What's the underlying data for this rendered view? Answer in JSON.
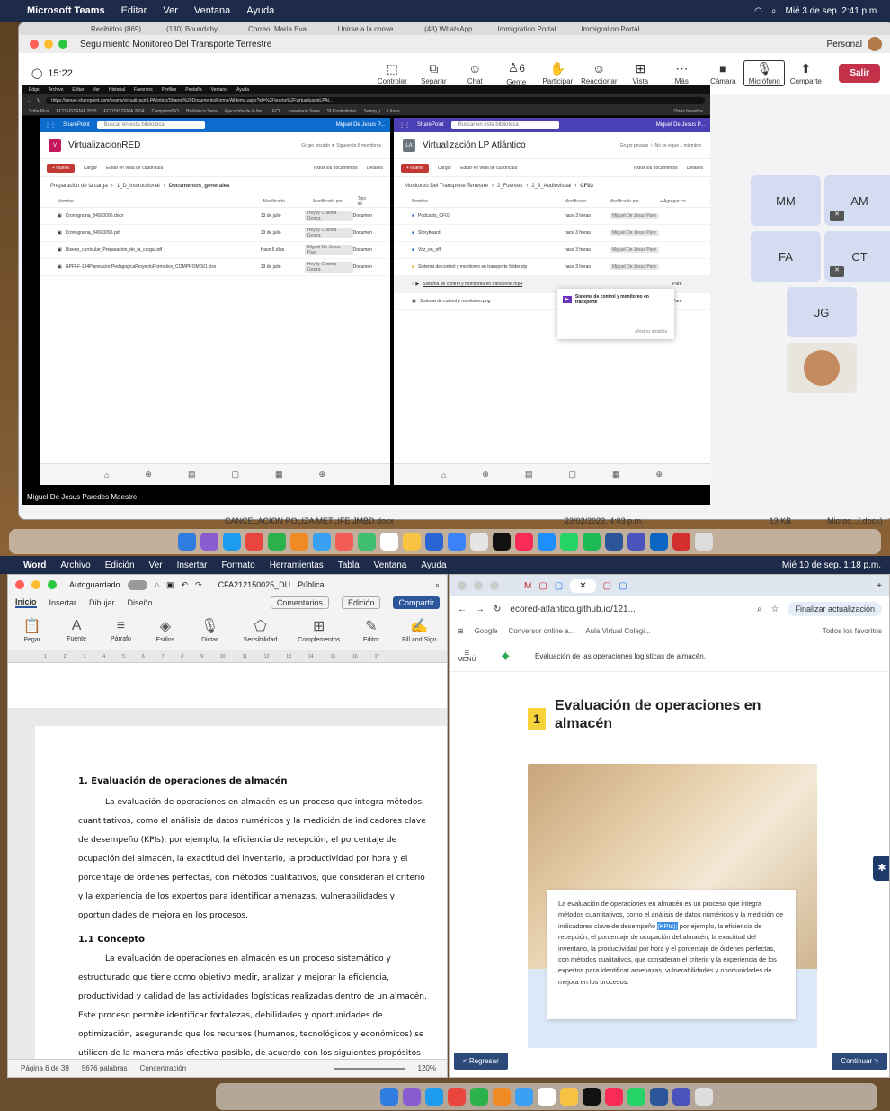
{
  "top_menubar": {
    "app": "Microsoft Teams",
    "items": [
      "Editar",
      "Ver",
      "Ventana",
      "Ayuda"
    ],
    "clock": "Mié 3 de sep. 2:41 p.m."
  },
  "teams": {
    "browser_tabs": [
      "Recibidos (869)",
      "(130) Boundaby...",
      "Correo: Maria Eva...",
      "Unirse a la conve...",
      "(48) WhatsApp",
      "Immigration Portal",
      "Immigration Portal"
    ],
    "window_title": "Seguimiento Monitoreo Del Transporte Terrestre",
    "profile": "Personal",
    "timer": "15:22",
    "toolbar": [
      {
        "label": "Controlar",
        "icon": "control-icon"
      },
      {
        "label": "Separar",
        "icon": "popout-icon"
      },
      {
        "label": "Chat",
        "icon": "chat-icon"
      },
      {
        "label": "Gente",
        "icon": "people-icon",
        "count": "6"
      },
      {
        "label": "Participar",
        "icon": "raise-hand-icon"
      },
      {
        "label": "Reaccionar",
        "icon": "react-icon"
      },
      {
        "label": "Vista",
        "icon": "view-icon"
      },
      {
        "label": "Más",
        "icon": "more-icon"
      },
      {
        "label": "Cámara",
        "icon": "camera-off-icon"
      },
      {
        "label": "Micrófono",
        "icon": "mic-icon"
      },
      {
        "label": "Comparte",
        "icon": "share-icon"
      }
    ],
    "leave_label": "Salir",
    "presenter": "Miguel De Jesus Paredes Maestre",
    "participants": [
      "MM",
      "AM",
      "FA",
      "CT",
      "JG"
    ]
  },
  "shared": {
    "menu": [
      "Edge",
      "Archivo",
      "Editar",
      "Ver",
      "Historial",
      "Favoritos",
      "Perfiles",
      "Pestaña",
      "Ventana",
      "Ayuda"
    ],
    "url": "https://sena4.sharepoint.com/teams/virtualizacinLPAtlntico/Shared%20Documents/Forms/AllItems.aspx?id=%2Fteams%2FvirtualizacinLPAt...",
    "favorites": [
      "Sofia Plus",
      "ECOSISTEMA 2025",
      "ECOSISTEMA 2024",
      "CompromISO",
      "Biblioteca Sena",
      "Ejecución de la for...",
      "ECL",
      "Inventario Sena",
      "Sf Contratistas",
      "Sennp_t",
      "Libres",
      "Otros favoritos"
    ],
    "left": {
      "app": "SharePoint",
      "search": "Buscar en esta biblioteca",
      "user": "Miguel De Jesus P...",
      "site": "VirtualizacionRED",
      "site_meta": "Grupo privado  ★ Siguiendo  8 miembros",
      "new": "+ Nueva",
      "upload": "Cargar",
      "grid": "Editar en vista de cuadrícula",
      "alldocs": "Todos los documentos",
      "details": "Detalles",
      "breadcrumb": [
        "Preparación de la carga",
        "1_D_Instruccional",
        "Documentos_generales"
      ],
      "columns": [
        "Nombre",
        "Modificado",
        "Modificado por",
        "Tipo de"
      ],
      "files": [
        {
          "name": "Cronograma_84920096.docx",
          "mod": "13 de julio",
          "by": "Heydy Cristina Gonza",
          "type": "Documen"
        },
        {
          "name": "Cronograma_84920096.pdf",
          "mod": "13 de julio",
          "by": "Heydy Cristina Gonza",
          "type": "Documen"
        },
        {
          "name": "Diseno_curricular_Preparacion_de_la_carga.pdf",
          "mod": "Hace 6 días",
          "by": "Miguel De Jesus Pare",
          "type": "Documen"
        },
        {
          "name": "GPFI-F-134PlaneacionPedagogicaProyectoFormativo_COMPROMISO.xlsx",
          "mod": "13 de julio",
          "by": "Heydy Cristina Gonza",
          "type": "Documen"
        }
      ]
    },
    "right": {
      "app": "SharePoint",
      "search": "Buscar en esta biblioteca",
      "user": "Miguel De Jesus P...",
      "site": "Virtualización LP Atlántico",
      "site_meta": "Grupo privado  ☆ No se sigue  1 miembro",
      "new": "+ Nueva",
      "upload": "Cargar",
      "grid": "Editar en vista de cuadrícula",
      "alldocs": "Todos los documentos",
      "details": "Detalles",
      "breadcrumb": [
        "Monitoreo Del Transporte Terrestre",
        "2_Fuentes",
        "2_3_Audiovisual",
        "CF03"
      ],
      "columns": [
        "Nombre",
        "Modificado",
        "Modificado por",
        "+ Agregar co..."
      ],
      "files": [
        {
          "name": "Podcasts_CF03",
          "mod": "hace 3 horas",
          "by": "Miguel De Jesus Pare"
        },
        {
          "name": "Storyboard",
          "mod": "hace 3 horas",
          "by": "Miguel De Jesus Pare"
        },
        {
          "name": "Voz_en_off",
          "mod": "hace 3 horas",
          "by": "Miguel De Jesus Pare"
        },
        {
          "name": "Sistema de control y monitoreo en transporte folder.zip",
          "mod": "hace 3 horas",
          "by": "Miguel De Jesus Pare"
        },
        {
          "name": "Sistema de control y monitoreo en transporte.mp4",
          "mod": "",
          "by": "Pare"
        },
        {
          "name": "Sistema de control y monitoreo.png",
          "mod": "",
          "by": "Pare"
        }
      ],
      "hover_card": "Sistema de control y monitoreo en transporte",
      "hover_more": "Mostrar detalles"
    }
  },
  "behind_window": {
    "file": "CANCELACION POLIZA METLIFE JMBD.docx",
    "date": "23/02/2023, 4:03 p.m.",
    "size": "13 KB",
    "kind": "Micros...(.docx)"
  },
  "bottom_menubar": {
    "app": "Word",
    "items": [
      "Archivo",
      "Edición",
      "Ver",
      "Insertar",
      "Formato",
      "Herramientas",
      "Tabla",
      "Ventana",
      "Ayuda"
    ],
    "clock": "Mié 10 de sep. 1:18 p.m."
  },
  "word": {
    "autosave": "Autoguardado",
    "filename": "CFA212150025_DU",
    "visibility": "Pública",
    "tabs": [
      "Inicio",
      "Insertar",
      "Dibujar",
      "Diseño"
    ],
    "comments": "Comentarios",
    "editing": "Edición",
    "share": "Compartir",
    "ribbon": [
      "Pegar",
      "Fuente",
      "Párrafo",
      "Estilos",
      "Dictar",
      "Sensibilidad",
      "Complementos",
      "Editor",
      "Fill and Sign"
    ],
    "ruler": [
      "1",
      "2",
      "3",
      "4",
      "5",
      "6",
      "7",
      "8",
      "9",
      "10",
      "11",
      "12",
      "13",
      "14",
      "15",
      "16",
      "17"
    ],
    "heading1": "1. Evaluación de operaciones de almacén",
    "para1": "La evaluación de operaciones en almacén es un proceso que integra métodos cuantitativos, como el análisis de datos numéricos y la medición de indicadores clave de desempeño (KPIs); por ejemplo, la eficiencia de recepción, el porcentaje de ocupación del almacén, la exactitud del inventario, la productividad por hora y el porcentaje de órdenes perfectas, con métodos cualitativos, que consideran el criterio y la experiencia de los expertos para identificar amenazas, vulnerabilidades y oportunidades de mejora en los procesos.",
    "heading2": "1.1   Concepto",
    "para2": "La evaluación de operaciones en almacén es un proceso sistemático y estructurado que tiene como objetivo medir, analizar y mejorar la eficiencia, productividad y calidad de las actividades logísticas realizadas dentro de un almacén. Este proceso permite identificar fortalezas, debilidades y oportunidades de optimización, asegurando que los recursos (humanos, tecnológicos y económicos) se utilicen de la manera más efectiva posible, de acuerdo con los siguientes propósitos clave:",
    "status": {
      "page": "Página 6 de 39",
      "words": "5676 palabras",
      "focus": "Concentración",
      "zoom": "120%"
    }
  },
  "browser": {
    "url": "ecored-atlantico.github.io/121...",
    "update": "Finalizar actualización",
    "favorites": [
      "Google",
      "Conversor online a...",
      "Aula Virtual Colegi...",
      "Todos los favoritos"
    ],
    "menu": "MENÚ",
    "lms_header": "Evaluación de las operaciones logísticas de almacén.",
    "number": "1",
    "title": "Evaluación de operaciones en almacén",
    "text_pre": "La evaluación de operaciones en almacén es un proceso que integra métodos cuantitativos, como el análisis de datos numéricos y la medición de indicadores clave de desempeño ",
    "text_hl": "(KPIs);",
    "text_post": " por ejemplo, la eficiencia de recepción, el porcentaje de ocupación del almacén, la exactitud del inventario, la productividad por hora y el porcentaje de órdenes perfectas, con métodos cualitativos, que consideran el criterio y la experiencia de los expertos para identificar amenazas, vulnerabilidades y oportunidades de mejora en los procesos.",
    "back": "< Regresar",
    "next": "Continuar >"
  },
  "colors": {
    "teams_leave": "#c4314b",
    "sharepoint": "#0f6ccf",
    "word_blue": "#2b579a",
    "highlight": "#3a8ee6",
    "lms_badge": "#f6d23b"
  }
}
